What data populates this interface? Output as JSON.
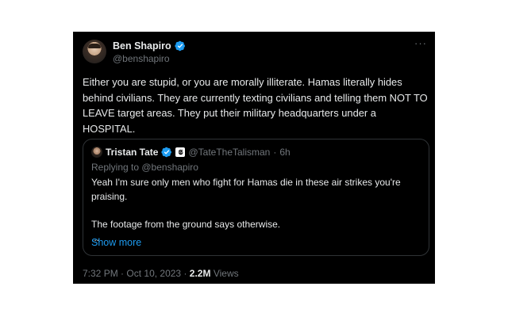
{
  "author": {
    "name": "Ben Shapiro",
    "handle": "@benshapiro",
    "verified": true,
    "verified_color": "#1d9bf0"
  },
  "more_icon": "more-horizontal-icon",
  "tweet": {
    "text": "Either you are stupid, or you are morally illiterate. Hamas literally hides behind civilians. They are currently texting civilians and telling them NOT TO LEAVE target areas. They put their military headquarters under a HOSPITAL."
  },
  "quoted": {
    "name": "Tristan Tate",
    "verified": true,
    "affiliate_badge": "𝕾",
    "handle": "@TateTheTalisman",
    "separator": "·",
    "time": "6h",
    "replying_prefix": "Replying to ",
    "replying_handle": "@benshapiro",
    "line1": "Yeah I'm sure only men who fight for Hamas die in these air strikes you're praising.",
    "line2": "The footage from the ground says otherwise.",
    "ellipsis": "...",
    "show_more": "Show more"
  },
  "meta": {
    "time": "7:32 PM",
    "dot": "·",
    "date": "Oct 10, 2023",
    "views_count": "2.2M",
    "views_label": "Views"
  },
  "colors": {
    "background": "#000000",
    "text": "#e7e9ea",
    "secondary": "#71767b",
    "link": "#1d9bf0",
    "border": "#2f3336"
  }
}
